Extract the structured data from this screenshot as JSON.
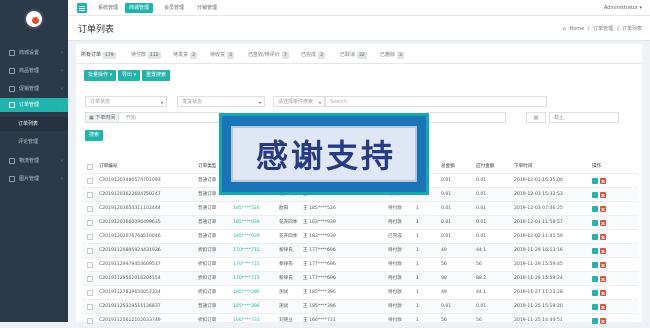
{
  "sidebar": {
    "items": [
      {
        "label": "商城设置",
        "chevron": "‹"
      },
      {
        "label": "商品管理",
        "chevron": "‹"
      },
      {
        "label": "促销管理",
        "chevron": "‹"
      },
      {
        "label": "订单管理",
        "chevron": "⌄"
      },
      {
        "label": "物流管理",
        "chevron": "‹"
      },
      {
        "label": "图片管理",
        "chevron": "‹"
      }
    ],
    "subitems": [
      {
        "label": "订单列表"
      },
      {
        "label": "评论管理"
      }
    ]
  },
  "topbar": {
    "tabs": [
      "系统管理",
      "商城管理",
      "会员管理",
      "分销管理"
    ],
    "active_tab": 1,
    "user": "Administrator ▾"
  },
  "page": {
    "title": "订单列表",
    "breadcrumb": [
      "Home",
      "订单管理",
      "订单列表"
    ]
  },
  "status_tabs": [
    {
      "label": "所有订单",
      "count": "179"
    },
    {
      "label": "待付款",
      "count": "112"
    },
    {
      "label": "待发货",
      "count": "3"
    },
    {
      "label": "待收货",
      "count": "3"
    },
    {
      "label": "已签收/待评价",
      "count": "7"
    },
    {
      "label": "已完成",
      "count": "3"
    },
    {
      "label": "已取消",
      "count": "32"
    },
    {
      "label": "已删除",
      "count": "3"
    }
  ],
  "toolbar": {
    "batch_label": "批量操作 ▾",
    "export_label": "导出 ▾",
    "reset_label": "重置搜索"
  },
  "filters": {
    "order_type": "订单状态",
    "delivery": "发货状态",
    "condition": "请选择条件搜索",
    "search_placeholder": "Search",
    "time_prefix": "下单时间",
    "start_placeholder": "开始",
    "end_placeholder": "截止",
    "search_button": "搜索"
  },
  "table": {
    "columns": [
      "订单编号",
      "订单类型",
      "",
      "",
      "",
      "",
      "总金额",
      "应付金额",
      "下单时间",
      "操作"
    ],
    "rows": [
      {
        "id": "C20191203480574701093",
        "type": "普通订单",
        "phone": "185****939",
        "pay": "花开四季",
        "name": "王 183****939",
        "status": "待付款",
        "qty": "1",
        "total": "0.01",
        "due": "0.01",
        "time": "2019-12-03 16:35:00"
      },
      {
        "id": "C20191203622684750247",
        "type": "普通订单",
        "phone": "185****939",
        "pay": "花开四季",
        "name": "王 183****939",
        "status": "待付款",
        "qty": "1",
        "total": "0.01",
        "due": "0.01",
        "time": "2019-12-03 15:32:53"
      },
      {
        "id": "C20191203654311102444",
        "type": "普通订单",
        "phone": "185****526",
        "pay": "欧阳",
        "name": "王 185****526",
        "status": "待付款",
        "qty": "1",
        "total": "0.01",
        "due": "0.01",
        "time": "2019-12-03 07:46:25"
      },
      {
        "id": "C20191203660096499635",
        "type": "普通订单",
        "phone": "185****939",
        "pay": "花开四季",
        "name": "王 163****939",
        "status": "待付款",
        "qty": "1",
        "total": "0.01",
        "due": "0.01",
        "time": "2019-12-03 11:58:57"
      },
      {
        "id": "C20191202076764510046",
        "type": "普通订单",
        "phone": "185****939",
        "pay": "花开四季",
        "name": "王 183****939",
        "status": "已完成",
        "qty": "1",
        "total": "0.01",
        "due": "0.01",
        "time": "2019-12-02 11:41:59"
      },
      {
        "id": "C20191129895924431926",
        "type": "折扣订单",
        "phone": "170****715",
        "pay": "黎律氏",
        "name": "王 177****696",
        "status": "待付款",
        "qty": "1",
        "total": "49",
        "due": "44.1",
        "time": "2019-11-29 16:13:16"
      },
      {
        "id": "C20191129979454609517",
        "type": "折扣订单",
        "phone": "170****715",
        "pay": "黎律氏",
        "name": "王 177****696",
        "status": "待付款",
        "qty": "1",
        "total": "56",
        "due": "56",
        "time": "2019-11-29 15:59:45"
      },
      {
        "id": "C20191129502016204154",
        "type": "折扣订单",
        "phone": "170****715",
        "pay": "黎律氏",
        "name": "王 177****696",
        "status": "待付款",
        "qty": "1",
        "total": "98",
        "due": "88.2",
        "time": "2019-11-29 15:59:24"
      },
      {
        "id": "C20191127839650057324",
        "type": "折扣订单",
        "phone": "185****396",
        "pay": "测试",
        "name": "王 185****396",
        "status": "待付款",
        "qty": "1",
        "total": "49",
        "due": "44.1",
        "time": "2019-11-27 11:23:28"
      },
      {
        "id": "C20191125319511136837",
        "type": "普通订单",
        "phone": "185****396",
        "pay": "测试",
        "name": "王 185****396",
        "status": "待付款",
        "qty": "1",
        "total": "0.01",
        "due": "0.01",
        "time": "2019-11-25 15:19:20"
      },
      {
        "id": "C20191125612102633749",
        "type": "折扣订单",
        "phone": "166****731",
        "pay": "刘德业",
        "name": "王 166****731",
        "status": "待付款",
        "qty": "1",
        "total": "56",
        "due": "56",
        "time": "2019-11-25 14:44:51"
      }
    ]
  },
  "watermark": {
    "text": "感谢支持"
  },
  "colors": {
    "accent": "#1fb5ac",
    "sidebar": "#2b3a4a",
    "danger": "#e74c3c"
  }
}
